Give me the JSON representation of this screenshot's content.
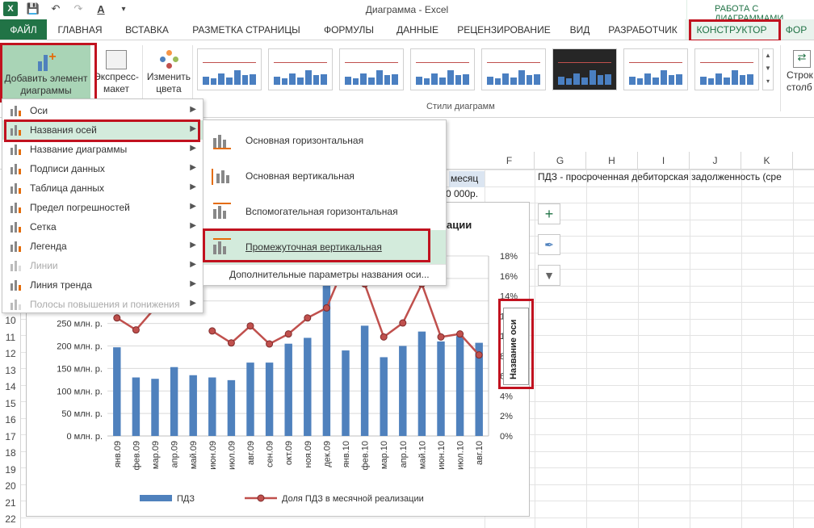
{
  "app": {
    "title": "Диаграмма - Excel",
    "context_tools": "РАБОТА С ДИАГРАММАМИ"
  },
  "tabs": [
    "ФАЙЛ",
    "ГЛАВНАЯ",
    "ВСТАВКА",
    "РАЗМЕТКА СТРАНИЦЫ",
    "ФОРМУЛЫ",
    "ДАННЫЕ",
    "РЕЦЕНЗИРОВАНИЕ",
    "ВИД",
    "РАЗРАБОТЧИК",
    "КОНСТРУКТОР",
    "ФОР"
  ],
  "ribbon": {
    "add_element_l1": "Добавить элемент",
    "add_element_l2": "диаграммы",
    "express_l1": "Экспресс-",
    "express_l2": "макет",
    "change_colors_l1": "Изменить",
    "change_colors_l2": "цвета",
    "chart_styles_group": "Стили диаграмм",
    "row_col_l1": "Строк",
    "row_col_l2": "столб"
  },
  "menu_main": [
    {
      "label": "Оси",
      "disabled": false,
      "arrow": true
    },
    {
      "label": "Названия осей",
      "disabled": false,
      "arrow": true
    },
    {
      "label": "Название диаграммы",
      "disabled": false,
      "arrow": true
    },
    {
      "label": "Подписи данных",
      "disabled": false,
      "arrow": true
    },
    {
      "label": "Таблица данных",
      "disabled": false,
      "arrow": true
    },
    {
      "label": "Предел погрешностей",
      "disabled": false,
      "arrow": true
    },
    {
      "label": "Сетка",
      "disabled": false,
      "arrow": true
    },
    {
      "label": "Легенда",
      "disabled": false,
      "arrow": true
    },
    {
      "label": "Линии",
      "disabled": true,
      "arrow": true
    },
    {
      "label": "Линия тренда",
      "disabled": false,
      "arrow": true
    },
    {
      "label": "Полосы повышения и понижения",
      "disabled": true,
      "arrow": true
    }
  ],
  "submenu": {
    "items": [
      "Основная горизонтальная",
      "Основная вертикальная",
      "Вспомогательная горизонтальная",
      "Промежуточная вертикальная"
    ],
    "more": "Дополнительные параметры названия оси..."
  },
  "sheet": {
    "columns": [
      "F",
      "G",
      "H",
      "I",
      "J",
      "K"
    ],
    "rows": [
      "10",
      "11",
      "12",
      "13",
      "14",
      "15",
      "16",
      "17",
      "18",
      "19",
      "20",
      "21",
      "22"
    ],
    "cell_e4": "месяц",
    "cell_e5": "0 000р.",
    "cell_g4": "ПДЗ - просроченная дебиторская задолженность (сре"
  },
  "side_buttons": [
    "plus-icon",
    "brush-icon",
    "filter-icon"
  ],
  "chart_data": {
    "type": "bar",
    "title": "ации",
    "secondary_axis_title": "Название оси",
    "categories": [
      "янв.09",
      "фев.09",
      "мар.09",
      "апр.09",
      "май.09",
      "июн.09",
      "июл.09",
      "авг.09",
      "сен.09",
      "окт.09",
      "ноя.09",
      "дек.09",
      "янв.10",
      "фев.10",
      "мар.10",
      "апр.10",
      "май.10",
      "июн.10",
      "июл.10",
      "авг.10"
    ],
    "series": [
      {
        "name": "ПДЗ",
        "type": "bar",
        "color": "#4f81bd",
        "values": [
          197,
          130,
          127,
          153,
          135,
          130,
          124,
          163,
          163,
          205,
          218,
          340,
          190,
          245,
          175,
          200,
          232,
          210,
          222,
          207
        ]
      },
      {
        "name": "Доля ПДЗ в месячной реализации",
        "type": "line",
        "color": "#c0504d",
        "values": [
          11.8,
          10.6,
          12.8,
          null,
          null,
          10.5,
          9.3,
          11.0,
          9.2,
          10.2,
          11.8,
          12.8,
          17.3,
          15.2,
          9.9,
          11.3,
          15.2,
          9.9,
          10.2,
          8.1
        ]
      }
    ],
    "yticks": [
      "0 млн. р.",
      "50 млн. р.",
      "100 млн. р.",
      "150 млн. р.",
      "200 млн. р.",
      "250 млн. р."
    ],
    "y2ticks": [
      "0%",
      "2%",
      "4%",
      "6%",
      "8%",
      "10%",
      "12%",
      "14%",
      "16%",
      "18%"
    ],
    "ylim": [
      0,
      400
    ],
    "y2lim": [
      0,
      18
    ]
  }
}
